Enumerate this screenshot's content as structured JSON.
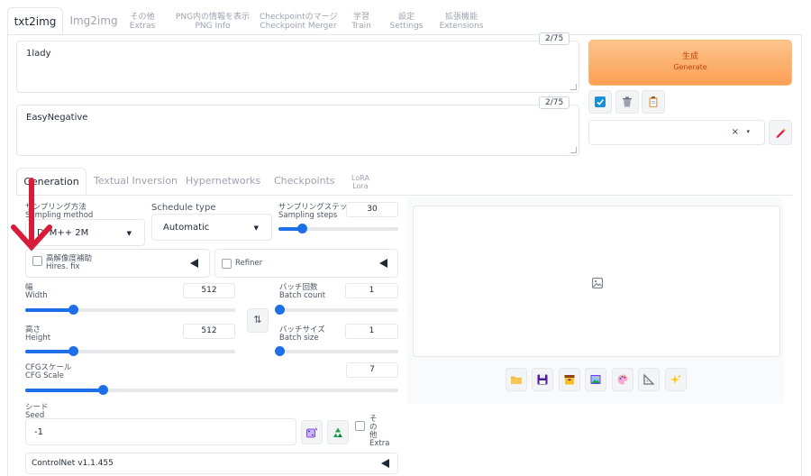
{
  "top_tabs": [
    {
      "label": "txt2img"
    },
    {
      "label": "Img2img"
    },
    {
      "jp": "その他",
      "en": "Extras"
    },
    {
      "jp": "PNG内の情報を表示",
      "en": "PNG Info"
    },
    {
      "jp": "Checkpointのマージ",
      "en": "Checkpoint Merger"
    },
    {
      "jp": "学習",
      "en": "Train"
    },
    {
      "jp": "設定",
      "en": "Settings"
    },
    {
      "jp": "拡張機能",
      "en": "Extensions"
    }
  ],
  "prompt": {
    "value": "1lady",
    "tokens": "2/75"
  },
  "negative_prompt": {
    "value": "EasyNegative",
    "tokens": "2/75"
  },
  "generate": {
    "jp": "生成",
    "en": "Generate"
  },
  "styles": {
    "clear": "×",
    "caret": "▾"
  },
  "sub_tabs": [
    {
      "label": "Generation"
    },
    {
      "label": "Textual Inversion"
    },
    {
      "label": "Hypernetworks"
    },
    {
      "label": "Checkpoints"
    },
    {
      "jp": "LoRA",
      "en": "Lora"
    }
  ],
  "sampling_method": {
    "jp": "サンプリング方法",
    "en": "Sampling method",
    "value": "DPM++ 2M"
  },
  "schedule_type": {
    "label": "Schedule type",
    "value": "Automatic"
  },
  "sampling_steps": {
    "jp": "サンプリングステップ数",
    "en": "Sampling steps",
    "value": "30",
    "min": 1,
    "max": 150,
    "current": 30
  },
  "hires_fix": {
    "jp": "高解像度補助",
    "en": "Hires. fix",
    "checked": false
  },
  "refiner": {
    "label": "Refiner",
    "checked": false
  },
  "width": {
    "jp": "幅",
    "en": "Width",
    "value": "512",
    "min": 64,
    "max": 2048,
    "current": 512
  },
  "height": {
    "jp": "高さ",
    "en": "Height",
    "value": "512",
    "min": 64,
    "max": 2048,
    "current": 512
  },
  "swap_icon": "⇅",
  "batch_count": {
    "jp": "バッチ回数",
    "en": "Batch count",
    "value": "1",
    "min": 1,
    "max": 100,
    "current": 1
  },
  "batch_size": {
    "jp": "バッチサイズ",
    "en": "Batch size",
    "value": "1",
    "min": 1,
    "max": 8,
    "current": 1
  },
  "cfg_scale": {
    "jp": "CFGスケール",
    "en": "CFG Scale",
    "value": "7",
    "min": 1,
    "max": 30,
    "current": 7
  },
  "seed": {
    "jp": "シード",
    "en": "Seed",
    "value": "-1"
  },
  "extra": {
    "jp": "その他",
    "en": "Extra",
    "checked": false
  },
  "controlnet": {
    "label": "ControlNet v1.1.455"
  },
  "colors": {
    "accent": "#1d6fe8",
    "generate": "#fb9f55",
    "annotation_arrow": "#d81b3a"
  }
}
